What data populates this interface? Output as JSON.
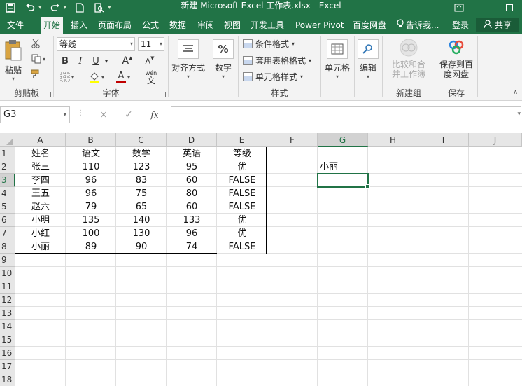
{
  "window": {
    "title": "新建 Microsoft Excel 工作表.xlsx - Excel",
    "accent_color": "#217346"
  },
  "quick_access": [
    "save-icon",
    "undo-icon",
    "redo-icon",
    "new-file-icon",
    "print-preview-icon"
  ],
  "tabs": [
    {
      "label": "文件",
      "active": false
    },
    {
      "label": "开始",
      "active": true
    },
    {
      "label": "插入",
      "active": false
    },
    {
      "label": "页面布局",
      "active": false
    },
    {
      "label": "公式",
      "active": false
    },
    {
      "label": "数据",
      "active": false
    },
    {
      "label": "审阅",
      "active": false
    },
    {
      "label": "视图",
      "active": false
    },
    {
      "label": "开发工具",
      "active": false
    },
    {
      "label": "Power Pivot",
      "active": false
    },
    {
      "label": "百度网盘",
      "active": false
    }
  ],
  "tell_me": "告诉我...",
  "login": "登录",
  "share": "共享",
  "ribbon": {
    "clipboard": {
      "paste": "粘贴",
      "label": "剪贴板"
    },
    "font": {
      "name": "等线",
      "size": "11",
      "bold": "B",
      "italic": "I",
      "underline": "U",
      "label": "字体",
      "wen": "wén",
      "wen_char": "文"
    },
    "alignment": {
      "label": "对齐方式"
    },
    "number": {
      "label": "数字",
      "icon_text": "%"
    },
    "styles": {
      "conditional": "条件格式",
      "table": "套用表格格式",
      "cell": "单元格样式",
      "label": "样式"
    },
    "cells": {
      "label": "单元格"
    },
    "editing": {
      "label": "编辑"
    },
    "new_group": {
      "merge": "比较和合并工作簿",
      "label": "新建组"
    },
    "save": {
      "button": "保存到百度网盘",
      "label": "保存"
    }
  },
  "formula_bar": {
    "name_box": "G3",
    "cancel": "×",
    "enter": "✓",
    "fx": "fx",
    "content": ""
  },
  "sheet": {
    "columns": [
      "A",
      "B",
      "C",
      "D",
      "E",
      "F",
      "G",
      "H",
      "I",
      "J"
    ],
    "rows": [
      "1",
      "2",
      "3",
      "4",
      "5",
      "6",
      "7",
      "8",
      "9",
      "10",
      "11",
      "12",
      "13",
      "14",
      "15",
      "16",
      "17",
      "18"
    ],
    "selected_cell": "G3",
    "data": [
      [
        "姓名",
        "语文",
        "数学",
        "英语",
        "等级"
      ],
      [
        "张三",
        "110",
        "123",
        "95",
        "优"
      ],
      [
        "李四",
        "96",
        "83",
        "60",
        "FALSE"
      ],
      [
        "王五",
        "96",
        "75",
        "80",
        "FALSE"
      ],
      [
        "赵六",
        "79",
        "65",
        "60",
        "FALSE"
      ],
      [
        "小明",
        "135",
        "140",
        "133",
        "优"
      ],
      [
        "小红",
        "100",
        "130",
        "96",
        "优"
      ],
      [
        "小丽",
        "89",
        "90",
        "74",
        "FALSE"
      ]
    ],
    "g2": "小丽"
  }
}
